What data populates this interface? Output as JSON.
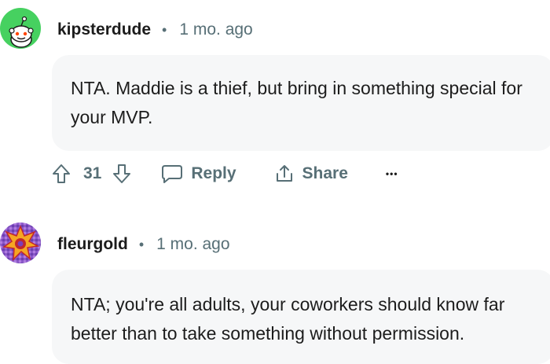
{
  "comments": [
    {
      "username": "kipsterdude",
      "separator": "•",
      "time": "1 mo. ago",
      "body": "NTA. Maddie is a thief, but bring in something special for your MVP.",
      "votes": "31",
      "reply_label": "Reply",
      "share_label": "Share",
      "more_label": "•••",
      "avatar_color": "#46d160"
    },
    {
      "username": "fleurgold",
      "separator": "•",
      "time": "1 mo. ago",
      "body": "NTA; you're all adults, your coworkers should know far better than to take something without permission.",
      "avatar_color": "#7a4fc0"
    }
  ],
  "colors": {
    "bubble_bg": "#f6f7f8",
    "meta": "#576f76",
    "text": "#1c1c1c"
  }
}
